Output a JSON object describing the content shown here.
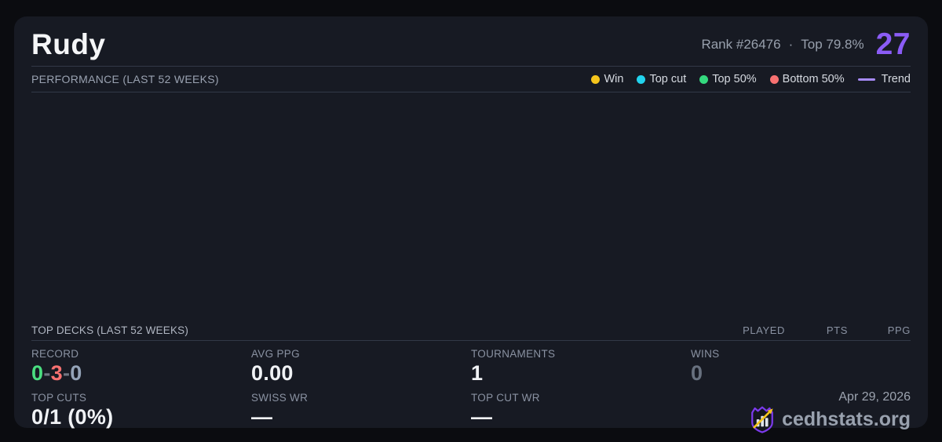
{
  "header": {
    "player_name": "Rudy",
    "rank_text": "Rank #26476",
    "separator": "·",
    "top_percent": "Top 79.8%",
    "score": "27"
  },
  "performance": {
    "title": "PERFORMANCE (LAST 52 WEEKS)",
    "chart_points": [],
    "legend": [
      {
        "label": "Win",
        "color": "#f5c51c",
        "swatch": "dot"
      },
      {
        "label": "Top cut",
        "color": "#22d3ee",
        "swatch": "dot"
      },
      {
        "label": "Top 50%",
        "color": "#34d97e",
        "swatch": "dot"
      },
      {
        "label": "Bottom 50%",
        "color": "#f87171",
        "swatch": "dot"
      },
      {
        "label": "Trend",
        "color": "#a78bfa",
        "swatch": "line"
      }
    ]
  },
  "top_decks": {
    "title": "TOP DECKS (LAST 52 WEEKS)",
    "columns": [
      "PLAYED",
      "PTS",
      "PPG"
    ],
    "rows": []
  },
  "stats": {
    "record": {
      "label": "RECORD",
      "wins": "0",
      "losses": "3",
      "draws": "0",
      "dash": "-"
    },
    "avg_ppg": {
      "label": "AVG PPG",
      "value": "0.00"
    },
    "tournaments": {
      "label": "TOURNAMENTS",
      "value": "1"
    },
    "wins": {
      "label": "WINS",
      "value": "0"
    },
    "top_cuts": {
      "label": "TOP CUTS",
      "value": "0/1 (0%)"
    },
    "swiss_wr": {
      "label": "SWISS WR",
      "value": "—"
    },
    "top_cut_wr": {
      "label": "TOP CUT WR",
      "value": "—"
    }
  },
  "footer": {
    "date": "Apr 29, 2026",
    "brand": "cedhstats.org"
  },
  "colors": {
    "score": "#8b5cf6",
    "record_win": "#4ade80",
    "record_loss": "#f87171",
    "record_draw": "#94a3b8",
    "record_dash": "#6f7683",
    "wins_dim": "#68717f",
    "trend": "#a78bfa"
  }
}
